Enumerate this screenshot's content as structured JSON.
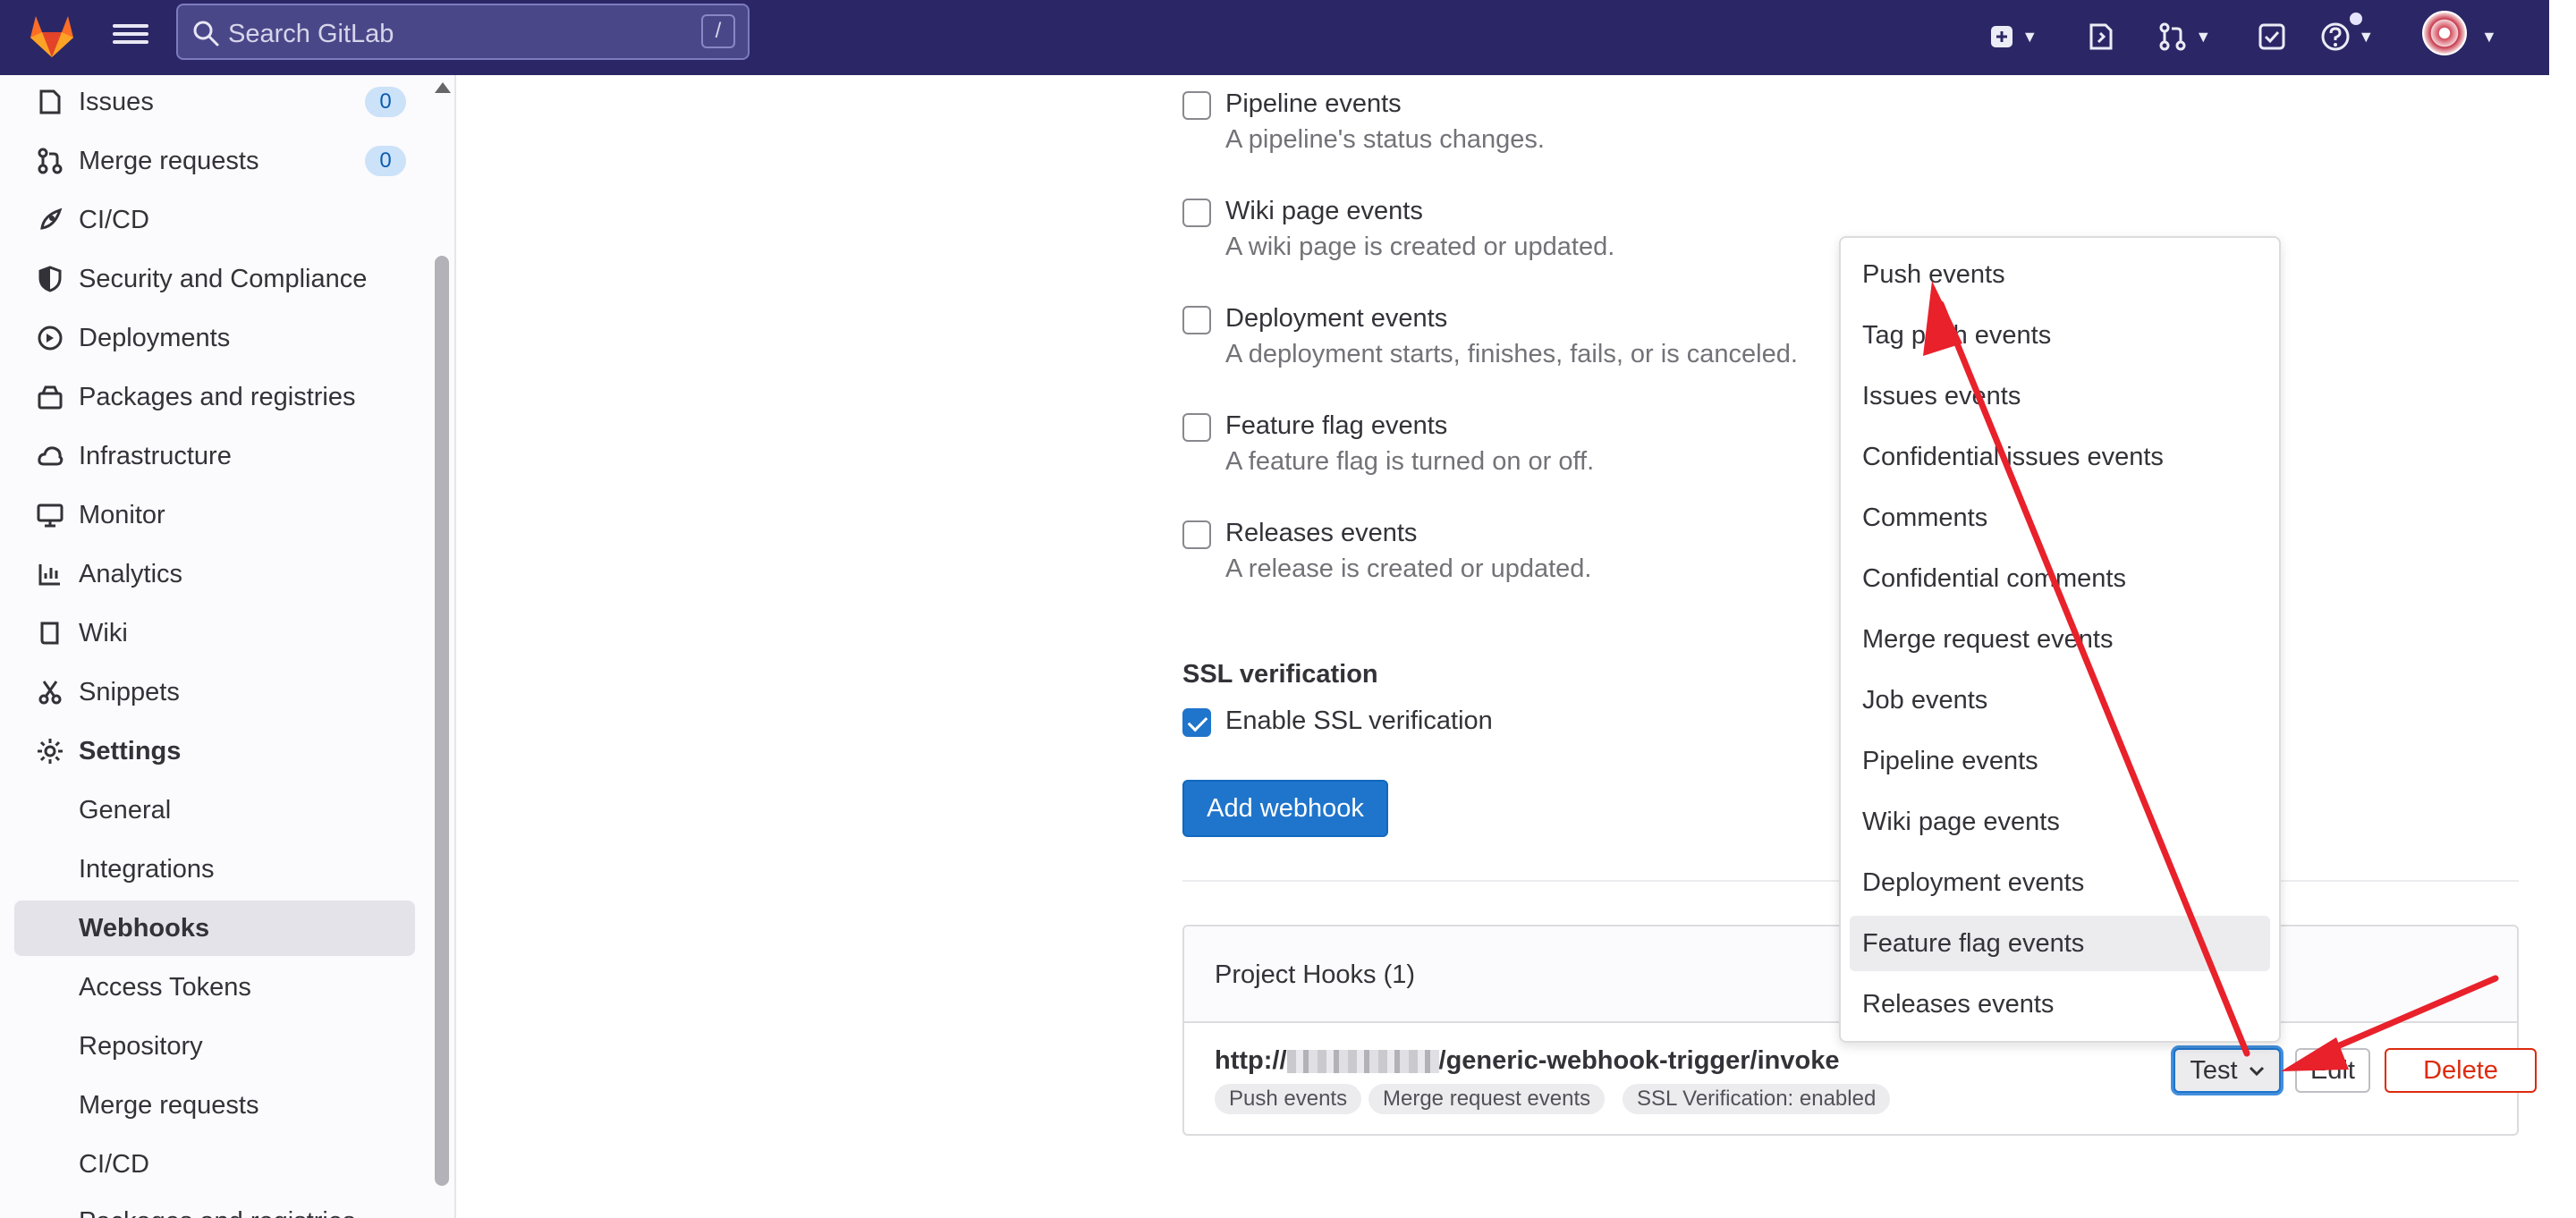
{
  "header": {
    "search_placeholder": "Search GitLab",
    "search_shortcut": "/",
    "icons": [
      "gitlab-logo",
      "menu-icon",
      "search-icon",
      "plus-icon",
      "issues-icon",
      "merge-requests-icon",
      "todo-icon",
      "help-icon",
      "avatar"
    ]
  },
  "sidebar": {
    "items": [
      {
        "label": "Issues",
        "badge": "0",
        "icon": "issues-icon"
      },
      {
        "label": "Merge requests",
        "badge": "0",
        "icon": "merge-request-icon"
      },
      {
        "label": "CI/CD",
        "icon": "rocket-icon"
      },
      {
        "label": "Security and Compliance",
        "icon": "shield-icon"
      },
      {
        "label": "Deployments",
        "icon": "deployments-icon"
      },
      {
        "label": "Packages and registries",
        "icon": "package-icon"
      },
      {
        "label": "Infrastructure",
        "icon": "cloud-icon"
      },
      {
        "label": "Monitor",
        "icon": "monitor-icon"
      },
      {
        "label": "Analytics",
        "icon": "chart-icon"
      },
      {
        "label": "Wiki",
        "icon": "book-icon"
      },
      {
        "label": "Snippets",
        "icon": "scissors-icon"
      },
      {
        "label": "Settings",
        "icon": "gear-icon"
      }
    ],
    "settings_sub": [
      "General",
      "Integrations",
      "Webhooks",
      "Access Tokens",
      "Repository",
      "Merge requests",
      "CI/CD",
      "Packages and registries"
    ],
    "active": "Webhooks"
  },
  "triggers": [
    {
      "title": "Pipeline events",
      "desc": "A pipeline's status changes.",
      "checked": false
    },
    {
      "title": "Wiki page events",
      "desc": "A wiki page is created or updated.",
      "checked": false
    },
    {
      "title": "Deployment events",
      "desc": "A deployment starts, finishes, fails, or is canceled.",
      "checked": false
    },
    {
      "title": "Feature flag events",
      "desc": "A feature flag is turned on or off.",
      "checked": false
    },
    {
      "title": "Releases events",
      "desc": "A release is created or updated.",
      "checked": false
    }
  ],
  "ssl": {
    "title": "SSL verification",
    "label": "Enable SSL verification",
    "checked": true
  },
  "add_webhook_label": "Add webhook",
  "hooks": {
    "title": "Project Hooks (1)",
    "url_prefix": "http://",
    "url_suffix": "/generic-webhook-trigger/invoke",
    "tags": [
      "Push events",
      "Merge request events",
      "SSL Verification: enabled"
    ],
    "buttons": {
      "test": "Test",
      "edit": "Edit",
      "delete": "Delete"
    }
  },
  "dropdown": {
    "items": [
      "Push events",
      "Tag push events",
      "Issues events",
      "Confidential issues events",
      "Comments",
      "Confidential comments",
      "Merge request events",
      "Job events",
      "Pipeline events",
      "Wiki page events",
      "Deployment events",
      "Feature flag events",
      "Releases events"
    ],
    "highlighted": "Feature flag events"
  },
  "colors": {
    "header": "#2b2766",
    "primary": "#1f75cb",
    "danger": "#dd2b0e",
    "annotation": "#e8212b"
  }
}
